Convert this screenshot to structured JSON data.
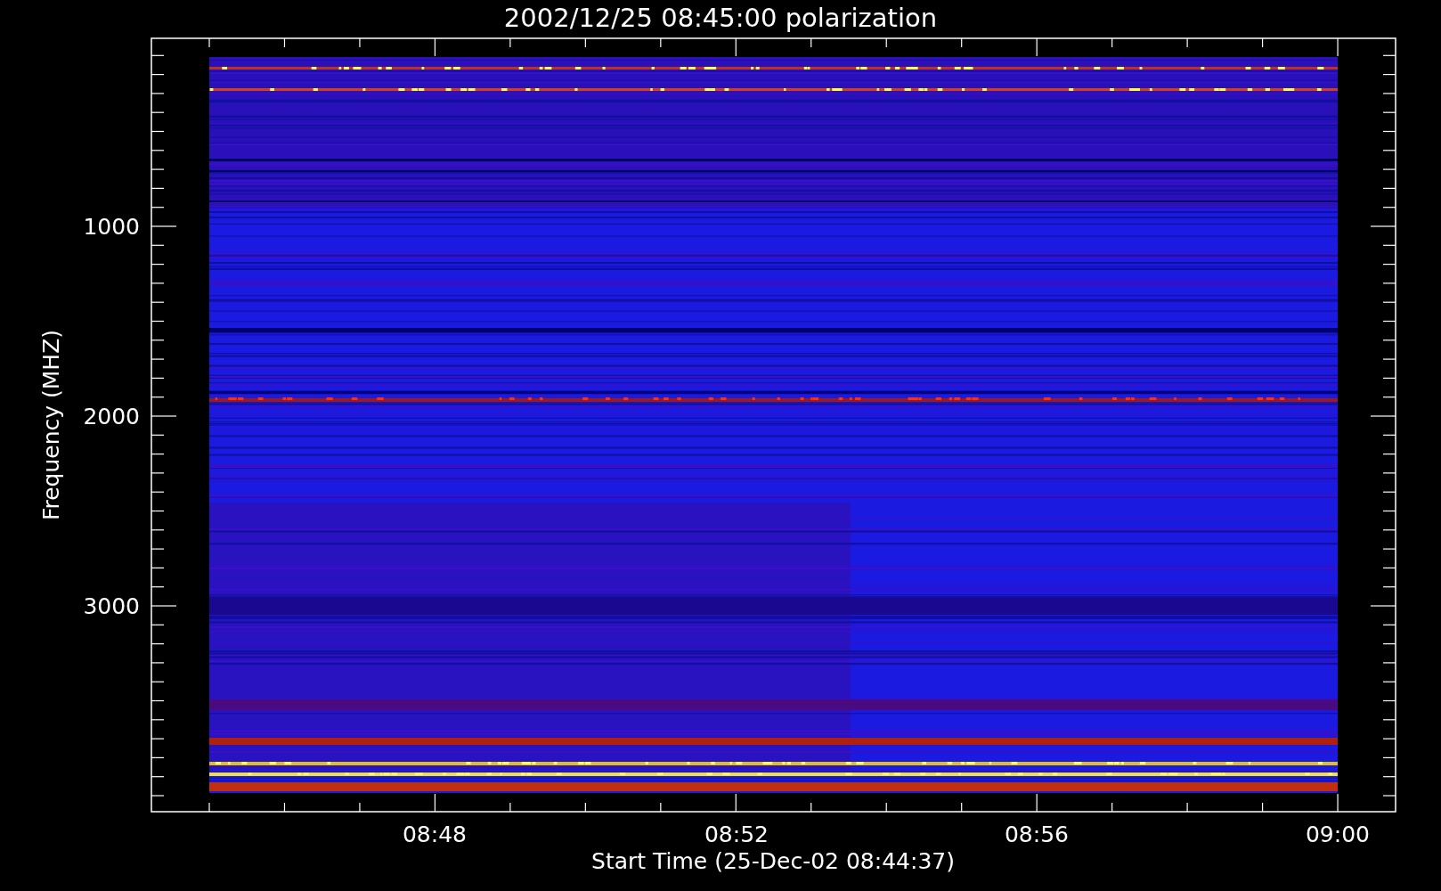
{
  "title": "2002/12/25 08:45:00 polarization",
  "y_axis": {
    "label": "Frequency (MHZ)",
    "ticks": [
      "1000",
      "2000",
      "3000"
    ]
  },
  "x_axis": {
    "label": "Start Time (25-Dec-02 08:44:37)",
    "ticks": [
      "08:48",
      "08:52",
      "08:56",
      "09:00"
    ]
  }
}
